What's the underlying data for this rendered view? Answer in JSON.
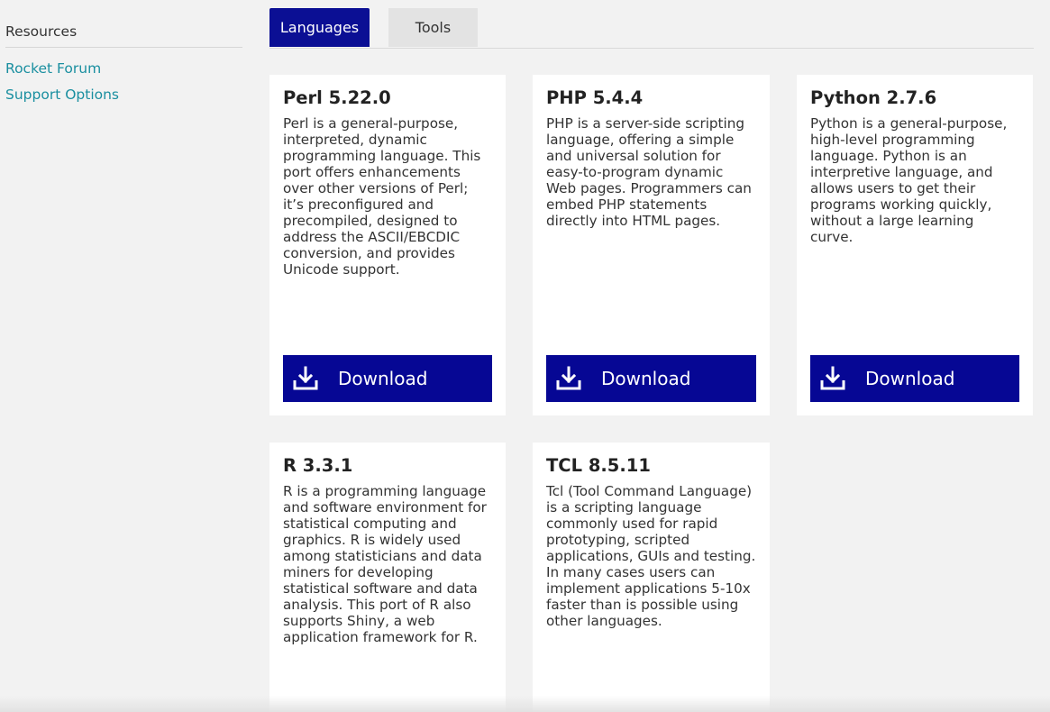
{
  "sidebar": {
    "heading": "Resources",
    "links": [
      "Rocket Forum",
      "Support Options"
    ]
  },
  "tabs": [
    {
      "label": "Languages",
      "active": true
    },
    {
      "label": "Tools",
      "active": false
    }
  ],
  "cards": [
    {
      "title": "Perl 5.22.0",
      "description": "Perl is a general-purpose, interpreted, dynamic programming language. This port offers enhancements over other versions of Perl; it’s preconfigured and precompiled, designed to address the ASCII/EBCDIC conversion, and provides Unicode support.",
      "button": "Download"
    },
    {
      "title": "PHP 5.4.4",
      "description": "PHP is a server-side scripting language, offering a simple and universal solution for easy-to-program dynamic Web pages. Programmers can embed PHP statements directly into HTML pages.",
      "button": "Download"
    },
    {
      "title": "Python 2.7.6",
      "description": "Python is a general-purpose, high-level programming language. Python is an interpretive language, and allows users to get their programs working quickly, without a large learning curve.",
      "button": "Download"
    },
    {
      "title": "R 3.3.1",
      "description": "R is a programming language and software environment for statistical computing and graphics. R is widely used among statisticians and data miners for developing statistical software and data analysis. This port of R also supports Shiny, a web application framework for R."
    },
    {
      "title": "TCL 8.5.11",
      "description": "Tcl (Tool Command Language) is a scripting language commonly used for rapid prototyping, scripted applications, GUIs and testing. In many cases users can implement applications 5-10x faster than is possible using other languages."
    }
  ],
  "icons": {
    "download": "download-icon"
  },
  "colors": {
    "accent": "#0b0f94",
    "link": "#1a8fa0"
  }
}
